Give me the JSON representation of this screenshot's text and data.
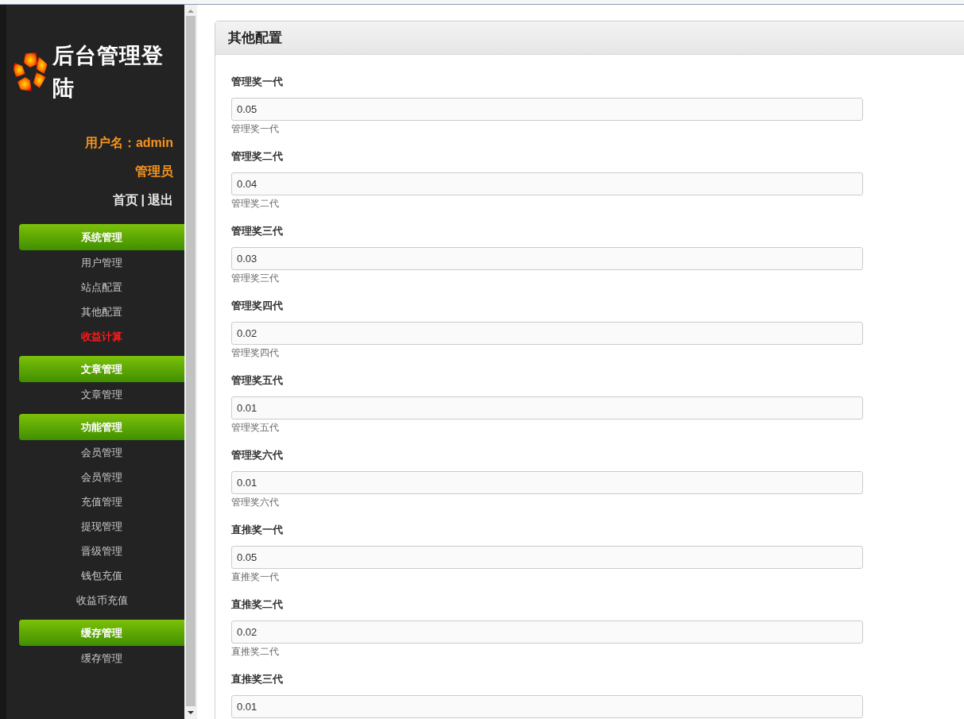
{
  "sidebar": {
    "logo_title": "后台管理登陆",
    "user_line": "用户名：admin",
    "role": "管理员",
    "links": [
      "首页",
      "退出"
    ],
    "link_separator": "|",
    "groups": [
      {
        "title": "系统管理",
        "items": [
          {
            "label": "用户管理",
            "selected": false
          },
          {
            "label": "站点配置",
            "selected": false
          },
          {
            "label": "其他配置",
            "selected": false
          },
          {
            "label": "收益计算",
            "selected": true
          }
        ]
      },
      {
        "title": "文章管理",
        "items": [
          {
            "label": "文章管理",
            "selected": false
          }
        ]
      },
      {
        "title": "功能管理",
        "items": [
          {
            "label": "会员管理",
            "selected": false
          },
          {
            "label": "会员管理",
            "selected": false
          },
          {
            "label": "充值管理",
            "selected": false
          },
          {
            "label": "提现管理",
            "selected": false
          },
          {
            "label": "晋级管理",
            "selected": false
          },
          {
            "label": "钱包充值",
            "selected": false
          },
          {
            "label": "收益币充值",
            "selected": false
          }
        ]
      },
      {
        "title": "缓存管理",
        "items": [
          {
            "label": "缓存管理",
            "selected": false
          }
        ]
      }
    ]
  },
  "panel": {
    "title": "其他配置",
    "fields": [
      {
        "label": "管理奖一代",
        "value": "0.05",
        "hint": "管理奖一代"
      },
      {
        "label": "管理奖二代",
        "value": "0.04",
        "hint": "管理奖二代"
      },
      {
        "label": "管理奖三代",
        "value": "0.03",
        "hint": "管理奖三代"
      },
      {
        "label": "管理奖四代",
        "value": "0.02",
        "hint": "管理奖四代"
      },
      {
        "label": "管理奖五代",
        "value": "0.01",
        "hint": "管理奖五代"
      },
      {
        "label": "管理奖六代",
        "value": "0.01",
        "hint": "管理奖六代"
      },
      {
        "label": "直推奖一代",
        "value": "0.05",
        "hint": "直推奖一代"
      },
      {
        "label": "直推奖二代",
        "value": "0.02",
        "hint": "直推奖二代"
      },
      {
        "label": "直推奖三代",
        "value": "0.01"
      }
    ]
  }
}
